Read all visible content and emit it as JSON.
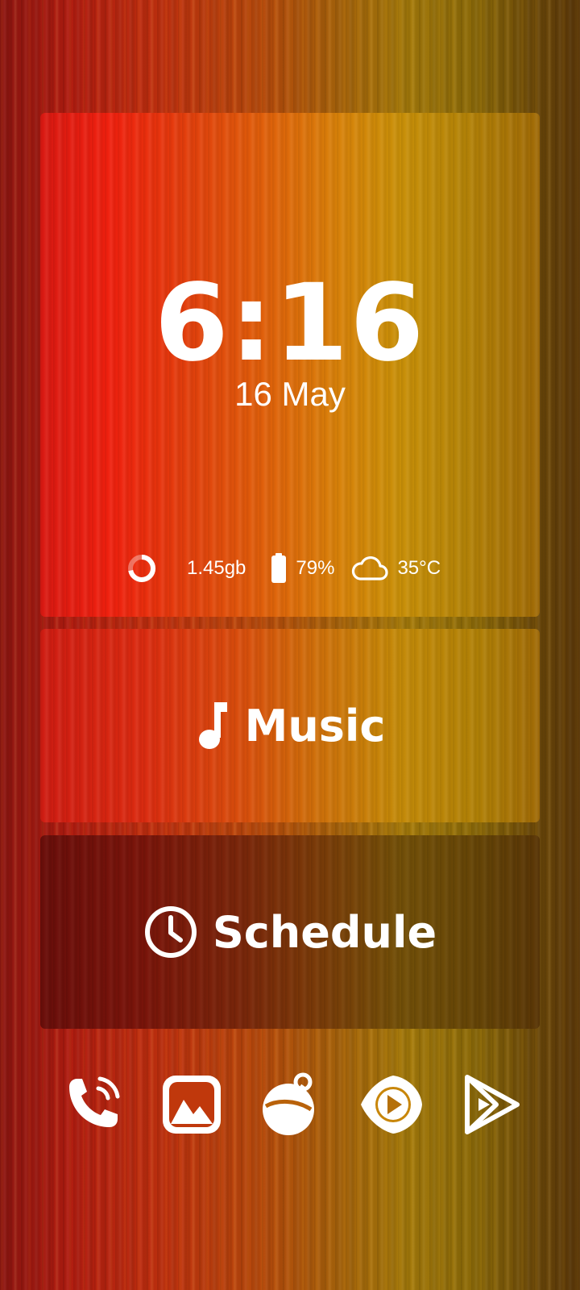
{
  "clock": {
    "time": "6:16",
    "date": "16 May"
  },
  "status": {
    "ram": "1.45gb",
    "ram_used_fraction": 0.72,
    "battery": "79%",
    "battery_level": 0.79,
    "weather_temp": "35°C",
    "icons": [
      "ram-ring-icon",
      "battery-icon",
      "cloud-icon"
    ]
  },
  "widgets": {
    "music": {
      "label": "Music",
      "icon": "music-note-icon"
    },
    "schedule": {
      "label": "Schedule",
      "icon": "clock-icon"
    }
  },
  "dock": {
    "apps": [
      "phone-icon",
      "gallery-icon",
      "camera-icon",
      "youtube-icon",
      "play-store-icon"
    ]
  },
  "colors": {
    "text": "#ffffff",
    "accent_red": "#e21a10",
    "accent_gold": "#c99008"
  }
}
